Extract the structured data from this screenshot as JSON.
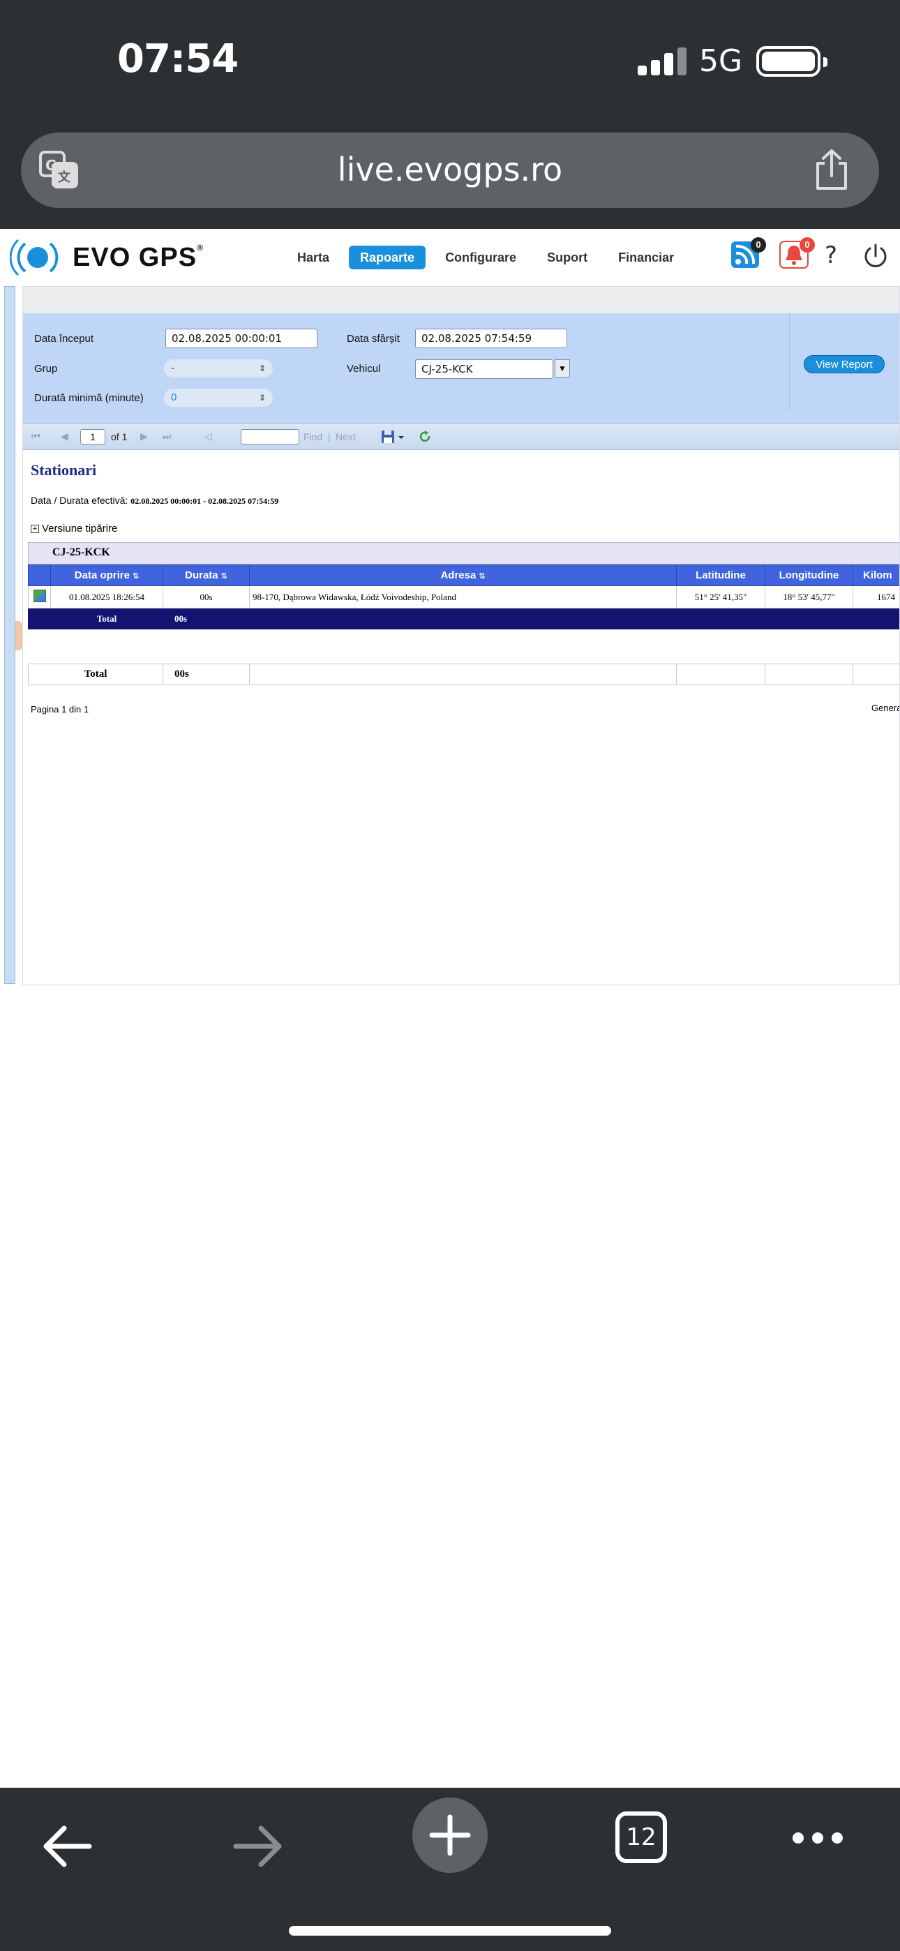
{
  "status_bar": {
    "time": "07:54",
    "network": "5G"
  },
  "browser": {
    "url": "live.evogps.ro",
    "tab_count": "12"
  },
  "app": {
    "logo": "EVO GPS",
    "nav": [
      {
        "label": "Harta"
      },
      {
        "label": "Rapoarte",
        "active": true
      },
      {
        "label": "Configurare"
      },
      {
        "label": "Suport"
      },
      {
        "label": "Financiar"
      }
    ],
    "feed_badge": "0",
    "alert_badge": "0",
    "help_label": "?"
  },
  "params": {
    "start_label": "Data început",
    "start_value": "02.08.2025 00:00:01",
    "end_label": "Data sfârșit",
    "end_value": "02.08.2025 07:54:59",
    "group_label": "Grup",
    "group_value": "-",
    "vehicle_label": "Vehicul",
    "vehicle_value": "CJ-25-KCK",
    "min_duration_label": "Durată minimă (minute)",
    "min_duration_value": "0",
    "view_report": "View Report"
  },
  "toolbar": {
    "page": "1",
    "of": "of 1",
    "find": "Find",
    "sep": "|",
    "next": "Next"
  },
  "report": {
    "title": "Stationari",
    "range_label": "Data / Durata efectivă:",
    "range_value": "02.08.2025 00:00:01 - 02.08.2025 07:54:59",
    "print_version": "Versiune tipărire",
    "group_vehicle": "CJ-25-KCK",
    "columns": [
      "Data oprire",
      "Durata",
      "Adresa",
      "Latitudine",
      "Longitudine",
      "Kilom"
    ],
    "rows": [
      {
        "date": "01.08.2025 18:26:54",
        "duration": "00s",
        "address": "98-170, Dąbrowa Widawska, Łódź Voivodeship, Poland",
        "lat": "51° 25' 41,35\"",
        "lon": "18° 53' 45,77\"",
        "km": "1674"
      }
    ],
    "group_total_label": "Total",
    "group_total_value": "00s",
    "grand_total_label": "Total",
    "grand_total_value": "00s",
    "pagination": "Pagina 1 din 1",
    "generated": "Genera"
  },
  "colors": {
    "accent": "#1a8fdc",
    "table_header": "#3f64dd",
    "total_row": "#131472",
    "params_bg": "#bfd6f6"
  }
}
